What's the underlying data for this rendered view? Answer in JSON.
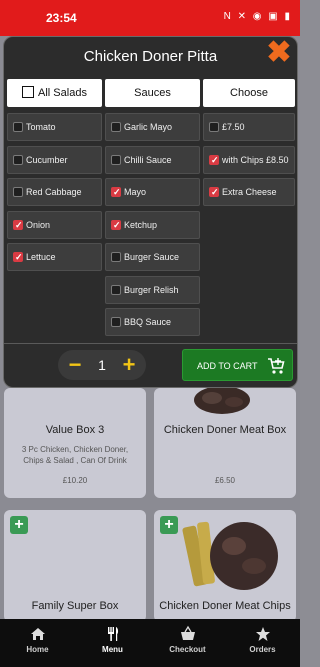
{
  "status_bar": {
    "time": "23:54",
    "icons": "N ✕ ◉ ▣ ▮"
  },
  "modal": {
    "title": "Chicken Doner Pitta",
    "columns": [
      {
        "label": "All Salads",
        "has_checkbox": true
      },
      {
        "label": "Sauces",
        "has_checkbox": false
      },
      {
        "label": "Choose",
        "has_checkbox": false
      }
    ],
    "salads": [
      {
        "label": "Tomato",
        "checked": false
      },
      {
        "label": "Cucumber",
        "checked": false
      },
      {
        "label": "Red Cabbage",
        "checked": false
      },
      {
        "label": "Onion",
        "checked": true
      },
      {
        "label": "Lettuce",
        "checked": true
      }
    ],
    "sauces": [
      {
        "label": "Garlic Mayo",
        "checked": false
      },
      {
        "label": "Chilli Sauce",
        "checked": false
      },
      {
        "label": "Mayo",
        "checked": true
      },
      {
        "label": "Ketchup",
        "checked": true
      },
      {
        "label": "Burger Sauce",
        "checked": false
      },
      {
        "label": "Burger Relish",
        "checked": false
      },
      {
        "label": "BBQ Sauce",
        "checked": false
      }
    ],
    "choose": [
      {
        "label": "£7.50",
        "checked": false
      },
      {
        "label": "with Chips £8.50",
        "checked": true
      },
      {
        "label": "Extra Cheese",
        "checked": true
      }
    ],
    "quantity": "1",
    "add_to_cart_label": "ADD TO CART"
  },
  "menu_cards": [
    {
      "title": "Value Box 3",
      "desc": "3 Pc Chicken, Chicken Doner, Chips & Salad , Can Of Drink",
      "price": "£10.20"
    },
    {
      "title": "Chicken Doner Meat Box",
      "desc": "",
      "price": "£6.50"
    },
    {
      "title": "Family Super Box",
      "desc": "",
      "price": ""
    },
    {
      "title": "Chicken Doner Meat Chips",
      "desc": "",
      "price": ""
    }
  ],
  "bottom_nav": [
    {
      "label": "Home",
      "icon": "home-icon"
    },
    {
      "label": "Menu",
      "icon": "cutlery-icon"
    },
    {
      "label": "Checkout",
      "icon": "basket-icon"
    },
    {
      "label": "Orders",
      "icon": "star-icon"
    }
  ],
  "colors": {
    "status_bar": "#e11b1b",
    "close": "#ef6b1e",
    "checked": "#d93b43",
    "cart_button": "#1c7a23",
    "qty_accent": "#f2c516"
  }
}
